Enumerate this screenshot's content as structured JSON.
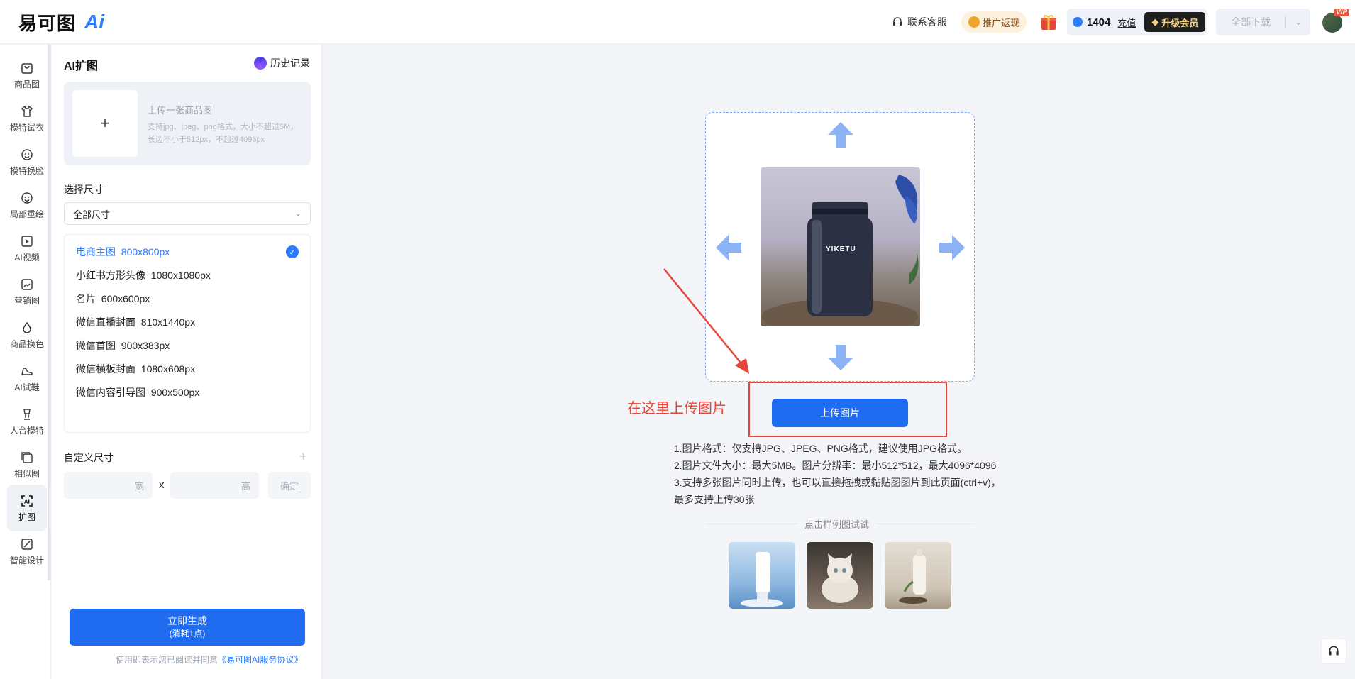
{
  "header": {
    "logo_text": "易可图",
    "logo_ai": "Ai",
    "service_label": "联系客服",
    "promo_label": "推广返现",
    "points": "1404",
    "recharge_label": "充值",
    "upgrade_label": "升级会员",
    "download_label": "全部下载",
    "vip_tag": "VIP"
  },
  "sidebar": {
    "items": [
      {
        "label": "商品图"
      },
      {
        "label": "模特试衣"
      },
      {
        "label": "模特换脸"
      },
      {
        "label": "局部重绘"
      },
      {
        "label": "AI视频"
      },
      {
        "label": "营销图"
      },
      {
        "label": "商品换色"
      },
      {
        "label": "AI试鞋"
      },
      {
        "label": "人台模特"
      },
      {
        "label": "相似图"
      },
      {
        "label": "扩图",
        "active": true
      },
      {
        "label": "智能设计"
      }
    ]
  },
  "panel": {
    "title": "AI扩图",
    "history_label": "历史记录",
    "upload_title": "上传一张商品图",
    "upload_desc": "支持jpg、jpeg、png格式，大小不超过5M，长边不小于512px，不超过4096px",
    "size_label": "选择尺寸",
    "size_select_value": "全部尺寸",
    "sizes": [
      {
        "name": "电商主图",
        "dim": "800x800px",
        "selected": true
      },
      {
        "name": "小红书方形头像",
        "dim": "1080x1080px"
      },
      {
        "name": "名片",
        "dim": "600x600px"
      },
      {
        "name": "微信直播封面",
        "dim": "810x1440px"
      },
      {
        "name": "微信首图",
        "dim": "900x383px"
      },
      {
        "name": "微信横板封面",
        "dim": "1080x608px"
      },
      {
        "name": "微信内容引导图",
        "dim": "900x500px"
      }
    ],
    "custom_label": "自定义尺寸",
    "width_placeholder": "宽",
    "height_placeholder": "高",
    "times": "x",
    "confirm_label": "确定",
    "generate_label": "立即生成",
    "generate_sub": "(消耗1点)",
    "agreement_prefix": "使用即表示您已阅读并同意",
    "agreement_link": "《易可图AI服务协议》"
  },
  "main": {
    "product_text": "YIKETU",
    "upload_button": "上传图片",
    "annotation": "在这里上传图片",
    "rules": [
      "1.图片格式：仅支持JPG、JPEG、PNG格式，建议使用JPG格式。",
      "2.图片文件大小：最大5MB。图片分辨率：最小512*512，最大4096*4096",
      "3.支持多张图片同时上传，也可以直接拖拽或黏贴图图片到此页面(ctrl+v)，",
      "最多支持上传30张"
    ],
    "samples_label": "点击样例图试试"
  },
  "colors": {
    "primary": "#1f6cf0",
    "annotation_red": "#e8453a",
    "arrow_blue": "#8cb4f5"
  }
}
